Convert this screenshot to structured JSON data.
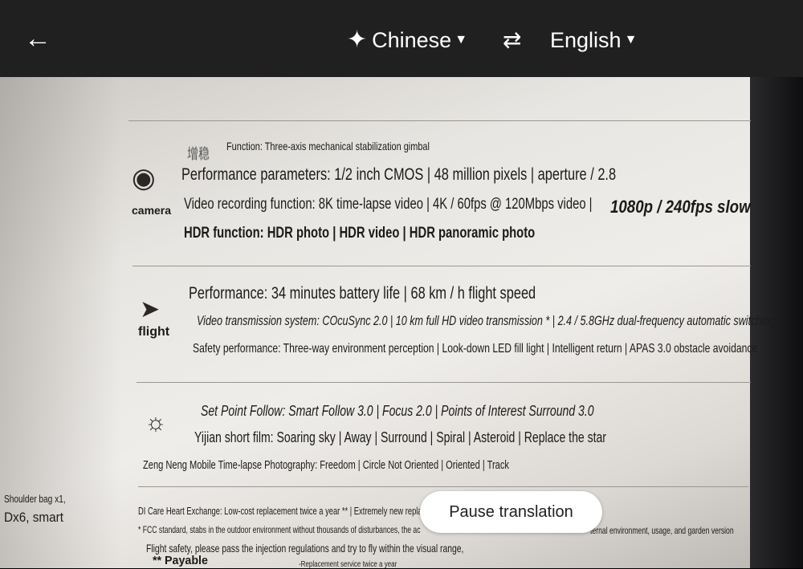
{
  "topbar": {
    "back_icon": "arrow-left-icon",
    "source_language": "Chinese",
    "target_language": "English",
    "swap_icon": "swap-arrows-icon",
    "auto_detect_icon": "sparkle-icon"
  },
  "overlay": {
    "camera_section": {
      "label": "camera",
      "icon": "camera-gimbal-icon",
      "chinese_fragment": "增稳",
      "lines": [
        "Function: Three-axis mechanical stabilization gimbal",
        "Performance parameters: 1/2 inch CMOS | 48 million pixels | aperture / 2.8",
        "Video recording function: 8K time-lapse video | 4K / 60fps @ 120Mbps video |",
        "1080p / 240fps slow",
        "HDR function: HDR photo | HDR video | HDR panoramic photo"
      ]
    },
    "flight_section": {
      "label": "flight",
      "icon": "paper-plane-icon",
      "lines": [
        "Performance: 34 minutes battery life | 68 km / h flight speed",
        "Video transmission system: COcuSync 2.0 | 10 km full HD video transmission * | 2.4 / 5.8GHz dual-frequency automatic switching",
        "Safety performance: Three-way environment perception | Look-down LED fill light | Intelligent return | APAS 3.0 obstacle avoidance"
      ]
    },
    "smart_section": {
      "icon": "lightbulb-icon",
      "lines": [
        "Set Point Follow: Smart Follow 3.0 | Focus 2.0 | Points of Interest Surround 3.0",
        "Yijian short film: Soaring sky | Away | Surround | Spiral | Asteroid | Replace the star",
        "Zeng Neng Mobile Time-lapse Photography: Freedom | Circle Not Oriented | Oriented | Track"
      ]
    },
    "left_column": [
      "Shoulder bag x1,",
      "Dx6, smart"
    ],
    "footer_lines": [
      "DI Care Heart Exchange: Low-cost replacement twice a year ** | Extremely new replac",
      "* FCC standard, stabs in the outdoor environment without thousands of disturbances, the ac",
      "ternal environment, usage, and garden version",
      "Flight safety, please pass the injection regulations and try to fly within the visual range,",
      "** Payable",
      "-Replacement service twice a year"
    ]
  },
  "pause_button": "Pause translation"
}
